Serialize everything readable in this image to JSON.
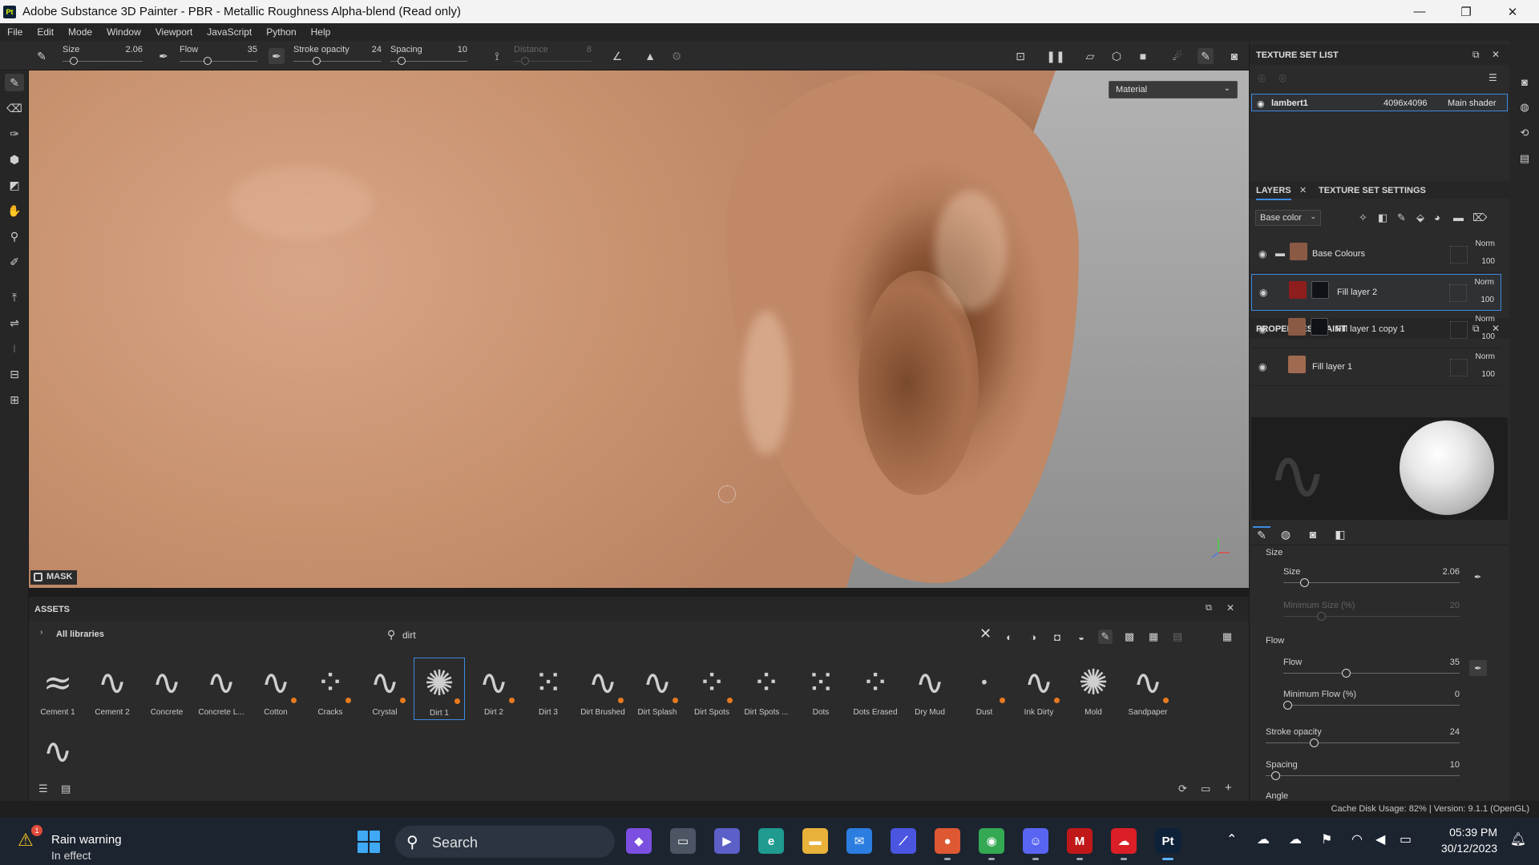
{
  "window": {
    "app_badge": "Pt",
    "title": "Adobe Substance 3D Painter - PBR - Metallic Roughness Alpha-blend (Read only)",
    "controls": {
      "minimize": "—",
      "maximize": "❐",
      "close": "✕"
    }
  },
  "menu": [
    "File",
    "Edit",
    "Mode",
    "Window",
    "Viewport",
    "JavaScript",
    "Python",
    "Help"
  ],
  "toolbar": {
    "size": {
      "label": "Size",
      "value": "2.06",
      "fraction": 0.1
    },
    "flow": {
      "label": "Flow",
      "value": "35",
      "fraction": 0.35
    },
    "stroke_opacity": {
      "label": "Stroke opacity",
      "value": "24",
      "fraction": 0.24
    },
    "spacing": {
      "label": "Spacing",
      "value": "10",
      "fraction": 0.1
    },
    "distance": {
      "label": "Distance",
      "value": "8",
      "fraction": 0.1
    }
  },
  "viewport": {
    "material_mode": "Material",
    "mask_label": "MASK"
  },
  "assets": {
    "title": "ASSETS",
    "libraries": "All libraries",
    "search_value": "dirt",
    "items": [
      {
        "name": "Cement 1",
        "glyph": "≈",
        "dot": false
      },
      {
        "name": "Cement 2",
        "glyph": "∿",
        "dot": false
      },
      {
        "name": "Concrete",
        "glyph": "∿",
        "dot": false
      },
      {
        "name": "Concrete L...",
        "glyph": "∿",
        "dot": false
      },
      {
        "name": "Cotton",
        "glyph": "∿",
        "dot": true
      },
      {
        "name": "Cracks",
        "glyph": "⁘",
        "dot": true
      },
      {
        "name": "Crystal",
        "glyph": "∿",
        "dot": true
      },
      {
        "name": "Dirt 1",
        "glyph": "✺",
        "dot": true
      },
      {
        "name": "Dirt 2",
        "glyph": "∿",
        "dot": true
      },
      {
        "name": "Dirt 3",
        "glyph": "⁙",
        "dot": false
      },
      {
        "name": "Dirt Brushed",
        "glyph": "∿",
        "dot": true
      },
      {
        "name": "Dirt Splash",
        "glyph": "∿",
        "dot": true
      },
      {
        "name": "Dirt Spots",
        "glyph": "⁘",
        "dot": true
      },
      {
        "name": "Dirt Spots ...",
        "glyph": "⁘",
        "dot": false
      },
      {
        "name": "Dots",
        "glyph": "⁙",
        "dot": false
      },
      {
        "name": "Dots Erased",
        "glyph": "⁘",
        "dot": false
      },
      {
        "name": "Dry Mud",
        "glyph": "∿",
        "dot": false
      },
      {
        "name": "Dust",
        "glyph": "·",
        "dot": true
      },
      {
        "name": "Ink Dirty",
        "glyph": "∿",
        "dot": true
      },
      {
        "name": "Mold",
        "glyph": "✺",
        "dot": false
      },
      {
        "name": "Sandpaper",
        "glyph": "∿",
        "dot": true
      },
      {
        "name": "",
        "glyph": "∿",
        "dot": false
      }
    ],
    "selected_index": 7
  },
  "texture_set_list": {
    "title": "TEXTURE SET LIST",
    "row": {
      "name": "lambert1",
      "resolution": "4096x4096",
      "shader": "Main shader"
    }
  },
  "layers": {
    "tab_layers": "LAYERS",
    "tab_settings": "TEXTURE SET SETTINGS",
    "channel": "Base color",
    "rows": [
      {
        "name": "Base Colours",
        "blend": "Norm",
        "opacity": "100",
        "color": "#8a5a44",
        "folder": true,
        "mask": false,
        "selected": false
      },
      {
        "name": "Fill layer 2",
        "blend": "Norm",
        "opacity": "100",
        "color": "#8e1d1d",
        "folder": false,
        "mask": true,
        "selected": true
      },
      {
        "name": "Fill layer 1 copy 1",
        "blend": "Norm",
        "opacity": "100",
        "color": "#8a5a44",
        "folder": false,
        "mask": true,
        "selected": false
      },
      {
        "name": "Fill layer 1",
        "blend": "Norm",
        "opacity": "100",
        "color": "#a06a50",
        "folder": false,
        "mask": false,
        "selected": false
      }
    ]
  },
  "properties": {
    "title": "PROPERTIES - PAINT",
    "section_size": "Size",
    "size": {
      "label": "Size",
      "value": "2.06",
      "fraction": 0.1
    },
    "min_size": {
      "label": "Minimum Size (%)",
      "value": "20",
      "fraction": 0.2
    },
    "section_flow": "Flow",
    "flow": {
      "label": "Flow",
      "value": "35",
      "fraction": 0.35
    },
    "min_flow": {
      "label": "Minimum Flow (%)",
      "value": "0",
      "fraction": 0.0
    },
    "stroke_opacity": {
      "label": "Stroke opacity",
      "value": "24",
      "fraction": 0.24
    },
    "spacing": {
      "label": "Spacing",
      "value": "10",
      "fraction": 0.03
    },
    "angle": {
      "label": "Angle"
    }
  },
  "status": {
    "cache": "Cache Disk Usage:   82% | Version: 9.1.1 (OpenGL)"
  },
  "taskbar": {
    "weather_line1": "Rain warning",
    "weather_line2": "In effect",
    "weather_badge": "1",
    "search_label": "Search",
    "time": "05:39 PM",
    "date": "30/12/2023",
    "apps": [
      {
        "name": "copilot-icon",
        "label": "◆",
        "color": "#7b4fe0"
      },
      {
        "name": "task-view-icon",
        "label": "▭",
        "color": "#4b5563"
      },
      {
        "name": "teams-icon",
        "label": "▶",
        "color": "#5b5fc7"
      },
      {
        "name": "edge-icon",
        "label": "e",
        "color": "#1f9b8f"
      },
      {
        "name": "file-explorer-icon",
        "label": "▬",
        "color": "#e8b23a"
      },
      {
        "name": "mail-icon",
        "label": "✉",
        "color": "#2b7de0"
      },
      {
        "name": "affinity-icon",
        "label": "⟋",
        "color": "#4a55e0"
      },
      {
        "name": "duckduckgo-icon",
        "label": "●",
        "color": "#de5833"
      },
      {
        "name": "chrome-icon",
        "label": "◉",
        "color": "#34a853"
      },
      {
        "name": "discord-icon",
        "label": "☺",
        "color": "#5865f2"
      },
      {
        "name": "mcafee-icon",
        "label": "M",
        "color": "#c01818"
      },
      {
        "name": "creative-cloud-icon",
        "label": "☁",
        "color": "#da1f26"
      },
      {
        "name": "substance-painter-icon",
        "label": "Pt",
        "color": "#0d2138"
      }
    ]
  }
}
